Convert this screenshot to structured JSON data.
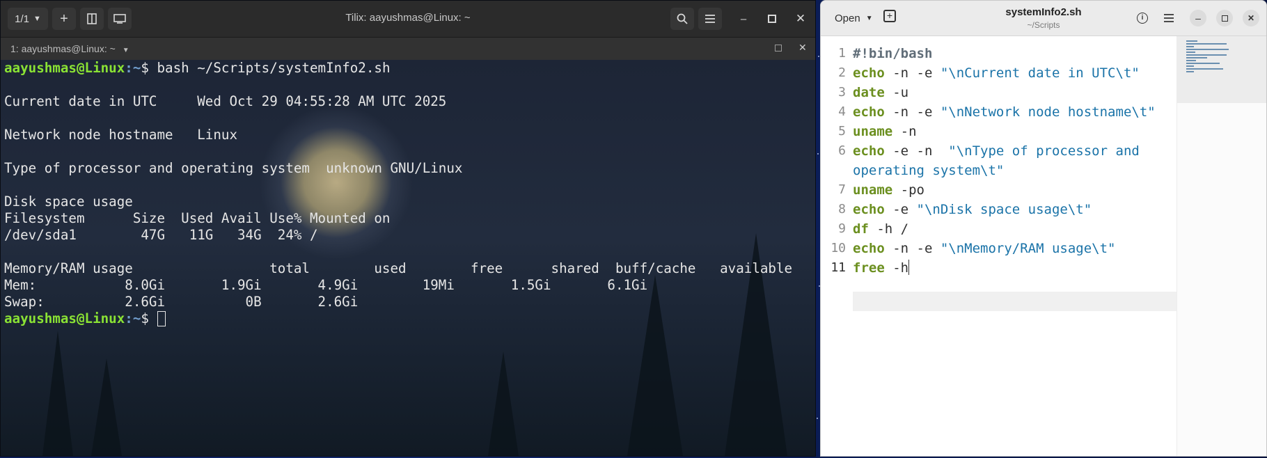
{
  "terminal": {
    "title": "Tilix: aayushmas@Linux: ~",
    "session_counter": "1/1",
    "tab_label": "1: aayushmas@Linux: ~",
    "prompt_user": "aayushmas@Linux",
    "prompt_path": ":~",
    "prompt_symbol": "$ ",
    "command": "bash ~/Scripts/systemInfo2.sh",
    "output_lines": [
      "",
      "Current date in UTC     Wed Oct 29 04:55:28 AM UTC 2025",
      "",
      "Network node hostname   Linux",
      "",
      "Type of processor and operating system  unknown GNU/Linux",
      "",
      "Disk space usage",
      "Filesystem      Size  Used Avail Use% Mounted on",
      "/dev/sda1        47G   11G   34G  24% /",
      "",
      "Memory/RAM usage                 total        used        free      shared  buff/cache   available",
      "Mem:           8.0Gi       1.9Gi       4.9Gi        19Mi       1.5Gi       6.1Gi",
      "Swap:          2.6Gi          0B       2.6Gi"
    ],
    "icons": {
      "add": "plus-icon",
      "split": "split-icon",
      "sidebar": "sidebar-icon",
      "search": "search-icon",
      "menu": "hamburger-menu-icon"
    }
  },
  "editor": {
    "open_label": "Open",
    "title": "systemInfo2.sh",
    "subtitle": "~/Scripts",
    "lines": [
      {
        "num": "1",
        "parts": [
          {
            "t": "#!bin/bash",
            "c": "shebang"
          }
        ]
      },
      {
        "num": "2",
        "parts": [
          {
            "t": "echo",
            "c": "kw"
          },
          {
            "t": " -n -e ",
            "c": ""
          },
          {
            "t": "\"\\nCurrent date in UTC\\t\"",
            "c": "str"
          }
        ]
      },
      {
        "num": "3",
        "parts": [
          {
            "t": "date",
            "c": "kw"
          },
          {
            "t": " -u",
            "c": ""
          }
        ]
      },
      {
        "num": "4",
        "parts": [
          {
            "t": "echo",
            "c": "kw"
          },
          {
            "t": " -n -e ",
            "c": ""
          },
          {
            "t": "\"\\nNetwork node hostname\\t\"",
            "c": "str"
          }
        ]
      },
      {
        "num": "5",
        "parts": [
          {
            "t": "uname",
            "c": "kw"
          },
          {
            "t": " -n",
            "c": ""
          }
        ]
      },
      {
        "num": "6",
        "parts": [
          {
            "t": "echo",
            "c": "kw"
          },
          {
            "t": " -e -n  ",
            "c": ""
          },
          {
            "t": "\"\\nType of processor and",
            "c": "str"
          }
        ]
      },
      {
        "num": "",
        "parts": [
          {
            "t": "operating system\\t\"",
            "c": "str"
          }
        ]
      },
      {
        "num": "7",
        "parts": [
          {
            "t": "uname",
            "c": "kw"
          },
          {
            "t": " -po",
            "c": ""
          }
        ]
      },
      {
        "num": "8",
        "parts": [
          {
            "t": "echo",
            "c": "kw"
          },
          {
            "t": " -e ",
            "c": ""
          },
          {
            "t": "\"\\nDisk space usage\\t\"",
            "c": "str"
          }
        ]
      },
      {
        "num": "9",
        "parts": [
          {
            "t": "df",
            "c": "kw"
          },
          {
            "t": " -h /",
            "c": ""
          }
        ]
      },
      {
        "num": "10",
        "parts": [
          {
            "t": "echo",
            "c": "kw"
          },
          {
            "t": " -n -e ",
            "c": ""
          },
          {
            "t": "\"\\nMemory/RAM usage\\t\"",
            "c": "str"
          }
        ]
      },
      {
        "num": "11",
        "parts": [
          {
            "t": "free",
            "c": "kw"
          },
          {
            "t": " -h",
            "c": ""
          }
        ]
      }
    ]
  }
}
